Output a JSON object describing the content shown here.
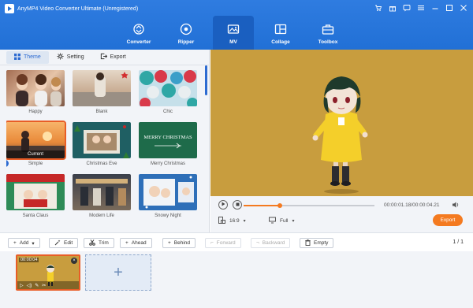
{
  "app": {
    "title": "AnyMP4 Video Converter Ultimate (Unregistered)"
  },
  "window_controls": [
    "cart-icon",
    "gift-icon",
    "feedback-icon",
    "menu-icon",
    "minimize-icon",
    "maximize-icon",
    "close-icon"
  ],
  "nav": {
    "items": [
      {
        "label": "Converter",
        "icon": "converter-icon"
      },
      {
        "label": "Ripper",
        "icon": "ripper-icon"
      },
      {
        "label": "MV",
        "icon": "mv-icon",
        "active": true
      },
      {
        "label": "Collage",
        "icon": "collage-icon"
      },
      {
        "label": "Toolbox",
        "icon": "toolbox-icon"
      }
    ]
  },
  "left_panel": {
    "tabs": [
      {
        "label": "Theme",
        "active": true
      },
      {
        "label": "Setting"
      },
      {
        "label": "Export"
      }
    ],
    "themes": [
      {
        "name": "Happy"
      },
      {
        "name": "Blank"
      },
      {
        "name": "Chic"
      },
      {
        "name": "Simple",
        "selected": true,
        "badge": "Current"
      },
      {
        "name": "Christmas Eve"
      },
      {
        "name": "Merry Christmas",
        "overlay": "MERRY CHRISTMAS"
      },
      {
        "name": "Santa Claus"
      },
      {
        "name": "Modern Life"
      },
      {
        "name": "Snowy Night"
      }
    ]
  },
  "player": {
    "time_current": "00:00:01.18",
    "time_total": "00:00:04.21",
    "progress": 0.28,
    "aspect_ratio": "16:9",
    "view_mode": "Full",
    "export_label": "Export"
  },
  "toolbar": {
    "add": "Add",
    "edit": "Edit",
    "trim": "Trim",
    "ahead": "Ahead",
    "behind": "Behind",
    "forward": "Forward",
    "backward": "Backward",
    "empty": "Empty",
    "pages": "1 / 1"
  },
  "timeline": {
    "clip_time": "00:00:04"
  },
  "colors": {
    "accent": "#f47a20",
    "brand": "#2170d6",
    "selected_border": "#e85d27"
  }
}
